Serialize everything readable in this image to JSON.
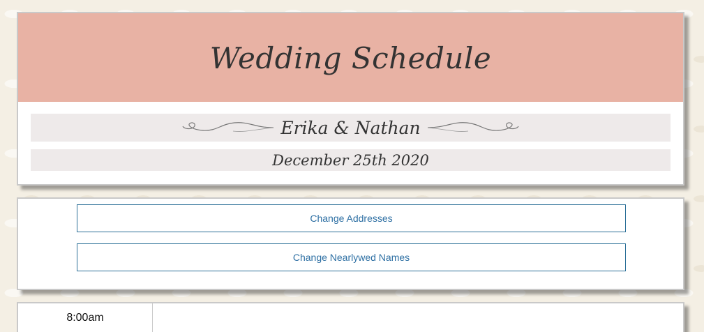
{
  "header": {
    "title": "Wedding Schedule",
    "names": "Erika & Nathan",
    "date": "December 25th 2020"
  },
  "actions": {
    "change_addresses": "Change Addresses",
    "change_names": "Change Nearlywed Names"
  },
  "schedule": {
    "rows": [
      {
        "time": "8:00am",
        "event": ""
      }
    ]
  },
  "colors": {
    "title_band": "#e8b2a4",
    "accent_link": "#2d6fa3",
    "bar_bg": "#eeeaea"
  }
}
